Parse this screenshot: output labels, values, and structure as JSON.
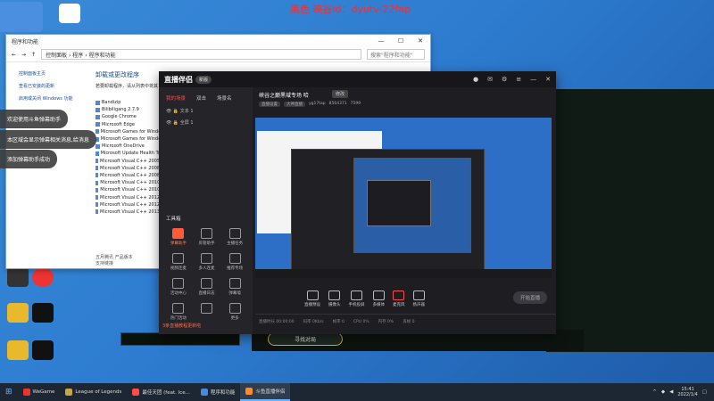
{
  "watermark": "黑色 峡谷id：dyutv-22fap",
  "desktop_icons": [
    {
      "label": "",
      "color": "#4b8fe0"
    },
    {
      "label": "",
      "color": "#ffffff"
    },
    {
      "label": "",
      "color": "#333333"
    },
    {
      "label": "",
      "color": "#e33"
    },
    {
      "label": "",
      "color": "#111"
    },
    {
      "label": "",
      "color": "#e8b92d"
    },
    {
      "label": "",
      "color": "#111"
    },
    {
      "label": "",
      "color": "#e8b92d"
    },
    {
      "label": "",
      "color": "#111"
    }
  ],
  "control_panel": {
    "title": "程序和功能",
    "address": "控制面板 › 程序 › 程序和功能",
    "search_placeholder": "搜索\"程序和功能\"",
    "left_links": [
      "控制面板主页",
      "查看已安装的更新",
      "启用或关闭 Windows 功能"
    ],
    "heading": "卸载或更改程序",
    "subtext": "若要卸载程序，请从列表中将其",
    "programs": [
      "Bandizip",
      "Bilibiligang 2.7.9",
      "Google Chrome",
      "Microsoft Edge",
      "Microsoft Games for Windows",
      "Microsoft Games for Windows",
      "Microsoft OneDrive",
      "Microsoft Update Health Tools",
      "Microsoft Visual C++ 2005 Re",
      "Microsoft Visual C++ 2008 Re",
      "Microsoft Visual C++ 2008 Re",
      "Microsoft Visual C++ 2010 x6",
      "Microsoft Visual C++ 2010 x8",
      "Microsoft Visual C++ 2012 Re",
      "Microsoft Visual C++ 2012 Re",
      "Microsoft Visual C++ 2013 Re"
    ],
    "bottom_text": "五月腾讯 产品版本",
    "bottom_sub": "支持链接"
  },
  "toasts": [
    "欢迎使用斗鱼弹幕助手",
    "本区域会显示弹幕相关消息,给消息",
    "添加弹幕助手成功"
  ],
  "streamer": {
    "app_name": "直播伴侣",
    "badge": "新版",
    "tabs": [
      "我的场景",
      "双击",
      "场景名"
    ],
    "scenes": [
      "文本 1",
      "全屏 1"
    ],
    "tools_title": "工具箱",
    "tools": [
      "弹幕助手",
      "房管助手",
      "主播任务",
      "视频连麦",
      "多人连麦",
      "推荐专场",
      "活动中心",
      "直播日志",
      "弹幕墙",
      "热门活动",
      "",
      "更多"
    ],
    "room_title": "峡谷之巅黑域专场 哈",
    "room_tag": "修改",
    "room_meta": [
      "直播设置",
      "大神直播",
      "yg17tap",
      "8564371",
      "7599"
    ],
    "controls": [
      "直播预设",
      "摄像头",
      "手机投屏",
      "多媒体",
      "麦克风",
      "扬声器"
    ],
    "start_button": "开始直播",
    "stats": [
      "直播时长 00:00:00",
      "码率 0Kb/s",
      "帧率 0",
      "CPU 0%",
      "内存 0%",
      "丢帧 0"
    ],
    "notice": "3条直播教程更新啦"
  },
  "game": {
    "find_button": "寻找对局"
  },
  "taskbar": {
    "items": [
      {
        "label": "WeGame",
        "color": "#e33"
      },
      {
        "label": "League of Legends",
        "color": "#c8a44a"
      },
      {
        "label": "最佳天团 (feat. Ice...",
        "color": "#ff4a4a"
      },
      {
        "label": "程序和功能",
        "color": "#4a8ad6"
      },
      {
        "label": "斗鱼直播伴侣",
        "color": "#ff8a2a"
      }
    ],
    "time": "15:41",
    "date": "2022/1/4"
  }
}
